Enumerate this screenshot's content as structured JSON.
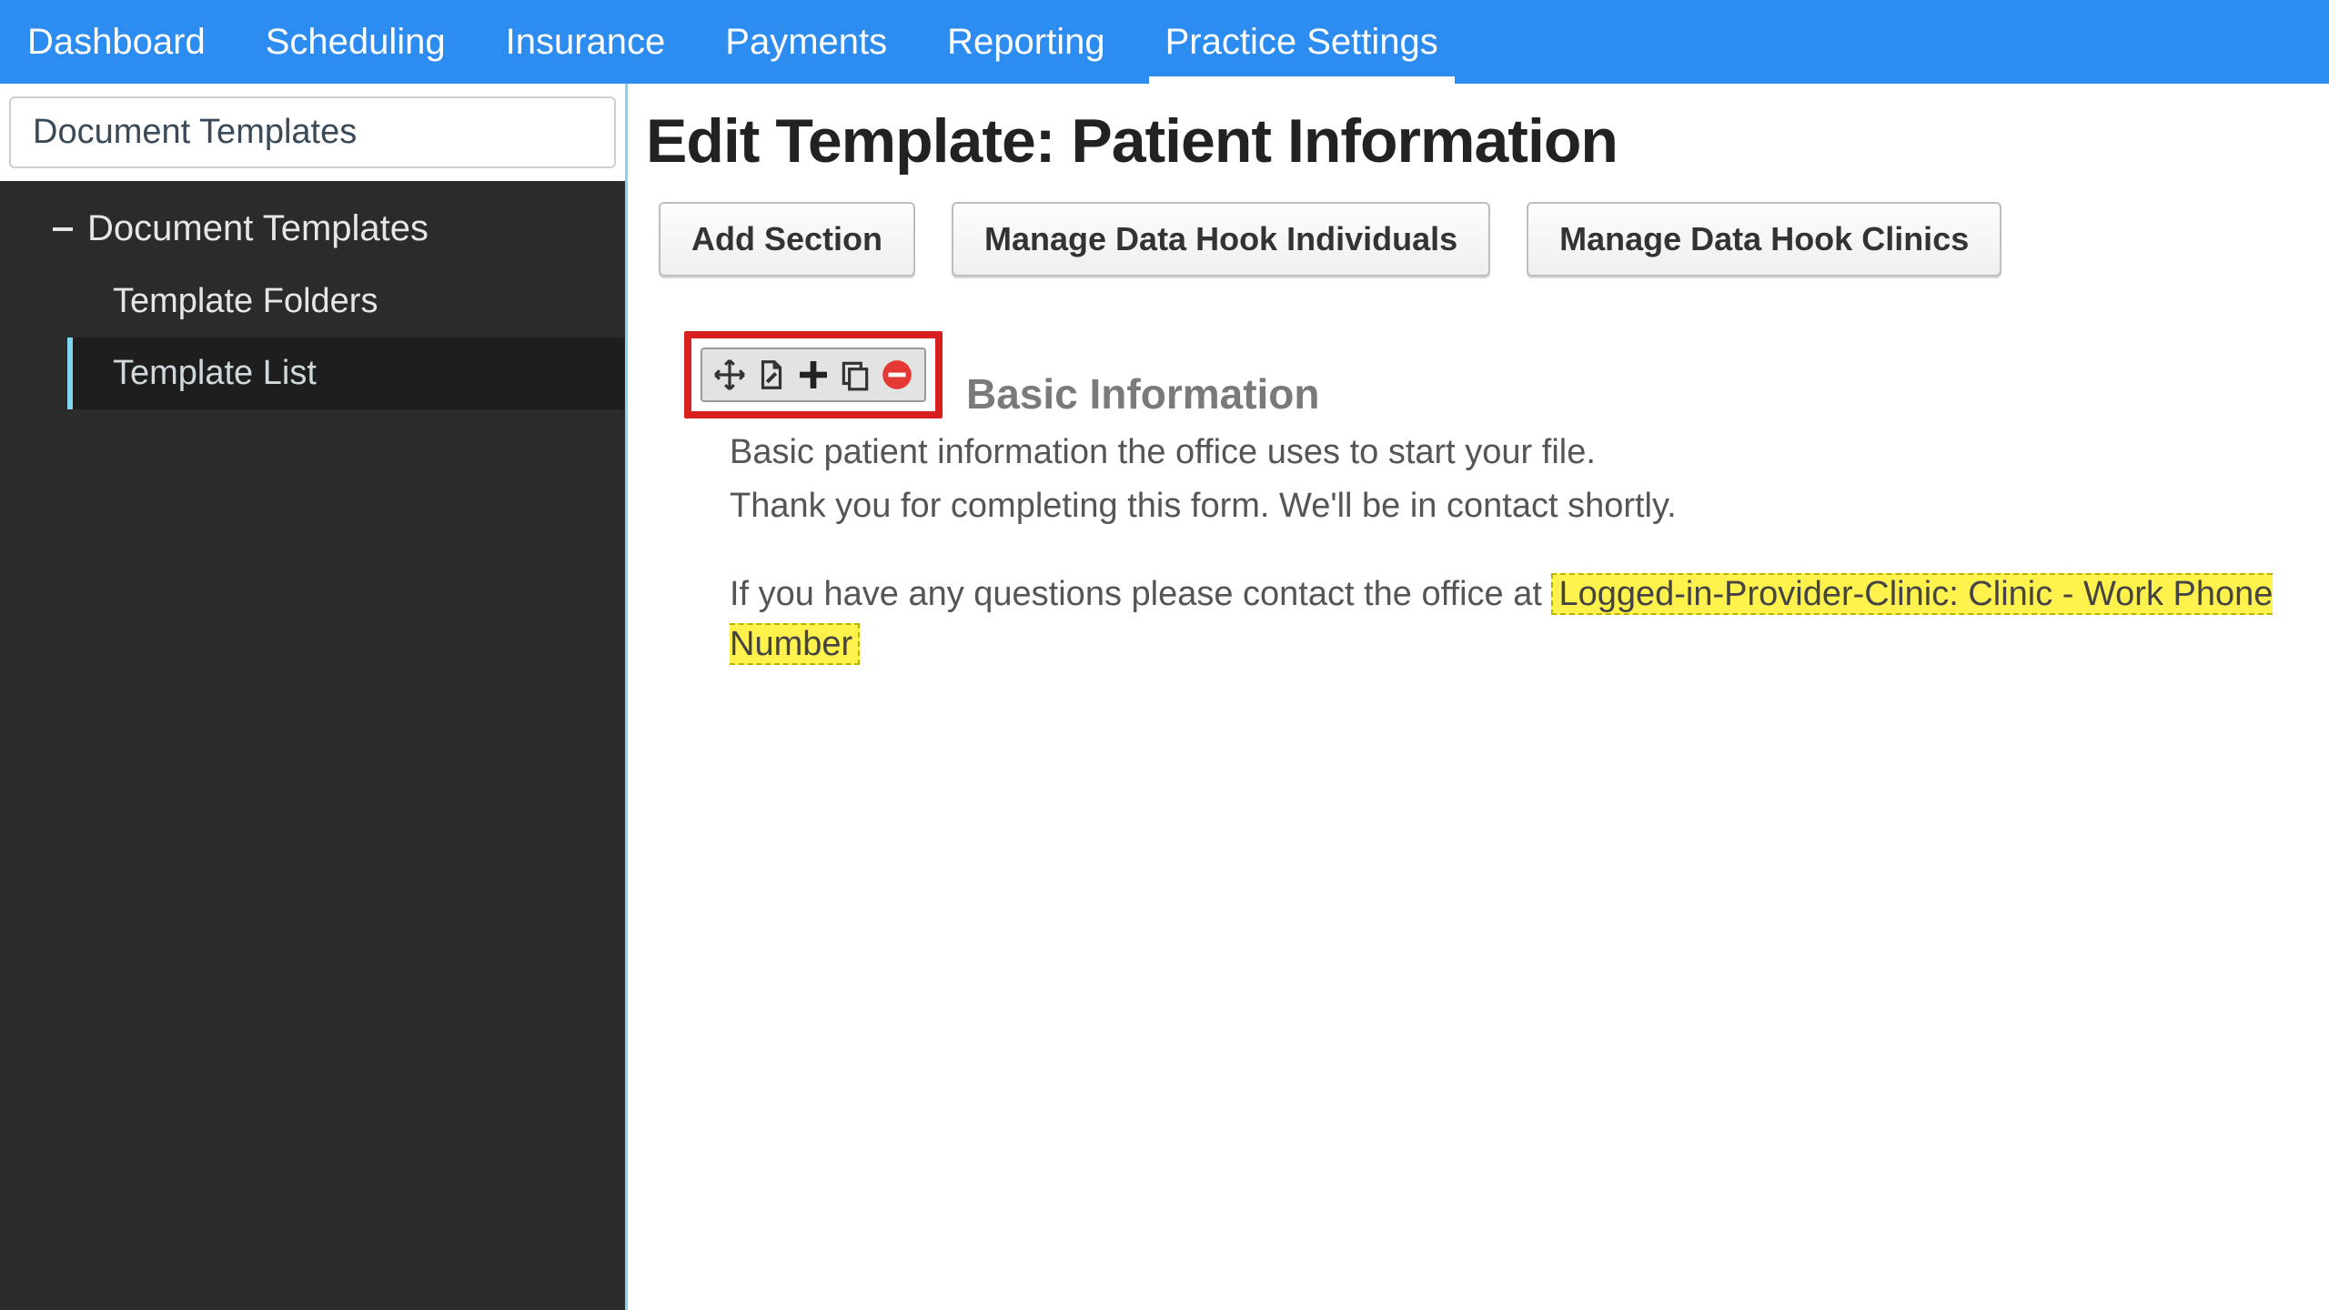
{
  "nav": {
    "items": [
      {
        "label": "Dashboard"
      },
      {
        "label": "Scheduling"
      },
      {
        "label": "Insurance"
      },
      {
        "label": "Payments"
      },
      {
        "label": "Reporting"
      },
      {
        "label": "Practice Settings"
      }
    ],
    "active_index": 5
  },
  "sidebar": {
    "header": "Document Templates",
    "group_label": "Document Templates",
    "children": [
      {
        "label": "Template Folders"
      },
      {
        "label": "Template List"
      }
    ],
    "active_child_index": 1
  },
  "main": {
    "title": "Edit Template: Patient Information",
    "buttons": {
      "add_section": "Add Section",
      "manage_individuals": "Manage Data Hook Individuals",
      "manage_clinics": "Manage Data Hook Clinics"
    },
    "section": {
      "title": "Basic Information",
      "line1": "Basic patient information the office uses to start your file.",
      "line2": "Thank you for completing this form. We'll be in contact shortly.",
      "line3_prefix": "If you have any questions please contact the office at ",
      "datahook": "Logged-in-Provider-Clinic: Clinic - Work Phone Number"
    },
    "toolbar_icons": {
      "move": "move-icon",
      "edit": "page-edit-icon",
      "add": "plus-icon",
      "copy": "copy-icon",
      "delete": "minus-circle-icon"
    }
  }
}
